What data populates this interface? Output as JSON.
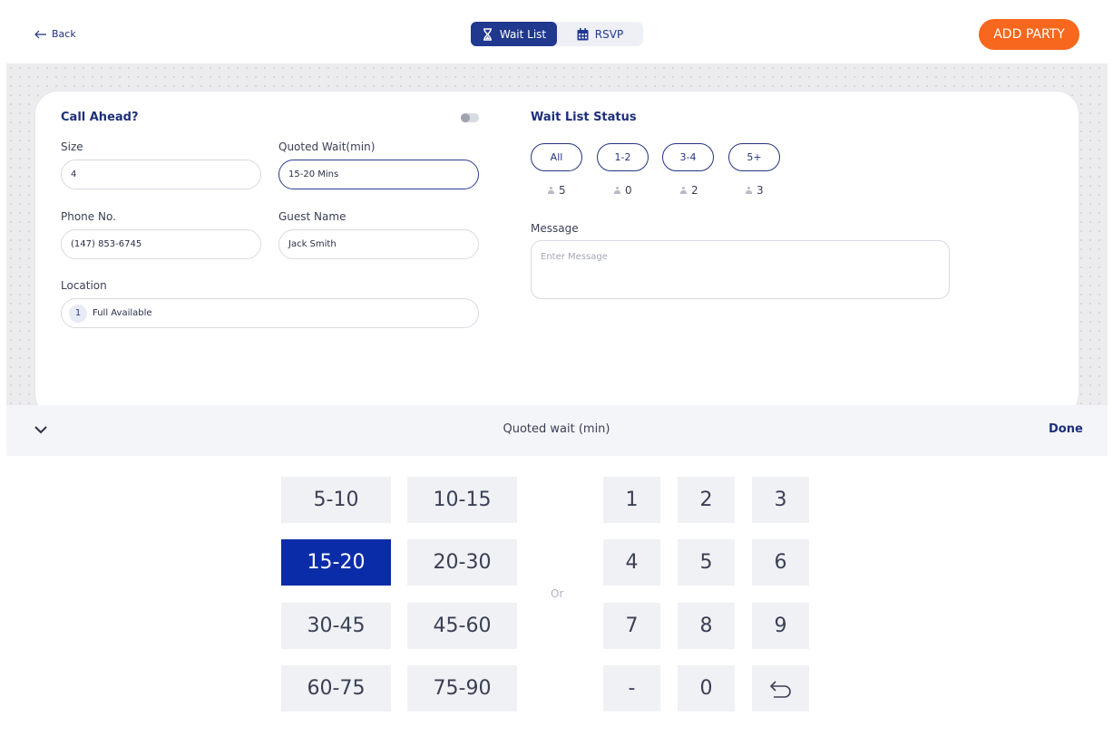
{
  "header": {
    "back_label": "Back",
    "tabs": [
      {
        "label": "Wait List",
        "icon": "hourglass-icon",
        "active": true
      },
      {
        "label": "RSVP",
        "icon": "calendar-icon",
        "active": false
      }
    ],
    "add_party_label": "ADD PARTY"
  },
  "form": {
    "call_ahead_label": "Call Ahead?",
    "call_ahead_on": false,
    "size_label": "Size",
    "size_value": "4",
    "quoted_wait_label": "Quoted Wait(min)",
    "quoted_wait_value": "15-20 Mins",
    "phone_label": "Phone No.",
    "phone_value": "(147) 853-6745",
    "guest_label": "Guest Name",
    "guest_value": "Jack Smith",
    "location_label": "Location",
    "location_badge": "1",
    "location_value": "Full Available"
  },
  "status": {
    "title": "Wait List Status",
    "filters": [
      "All",
      "1-2",
      "3-4",
      "5+"
    ],
    "counts": [
      "5",
      "0",
      "2",
      "3"
    ],
    "message_label": "Message",
    "message_placeholder": "Enter Message"
  },
  "picker": {
    "title": "Quoted wait (min)",
    "done_label": "Done",
    "ranges": [
      "5-10",
      "10-15",
      "15-20",
      "20-30",
      "30-45",
      "45-60",
      "60-75",
      "75-90"
    ],
    "selected_range": "15-20",
    "or_label": "Or",
    "numpad": [
      "1",
      "2",
      "3",
      "4",
      "5",
      "6",
      "7",
      "8",
      "9",
      "-",
      "0"
    ]
  },
  "colors": {
    "primary": "#21388f",
    "accent": "#f7671d",
    "selected_key": "#0b2ca8"
  }
}
